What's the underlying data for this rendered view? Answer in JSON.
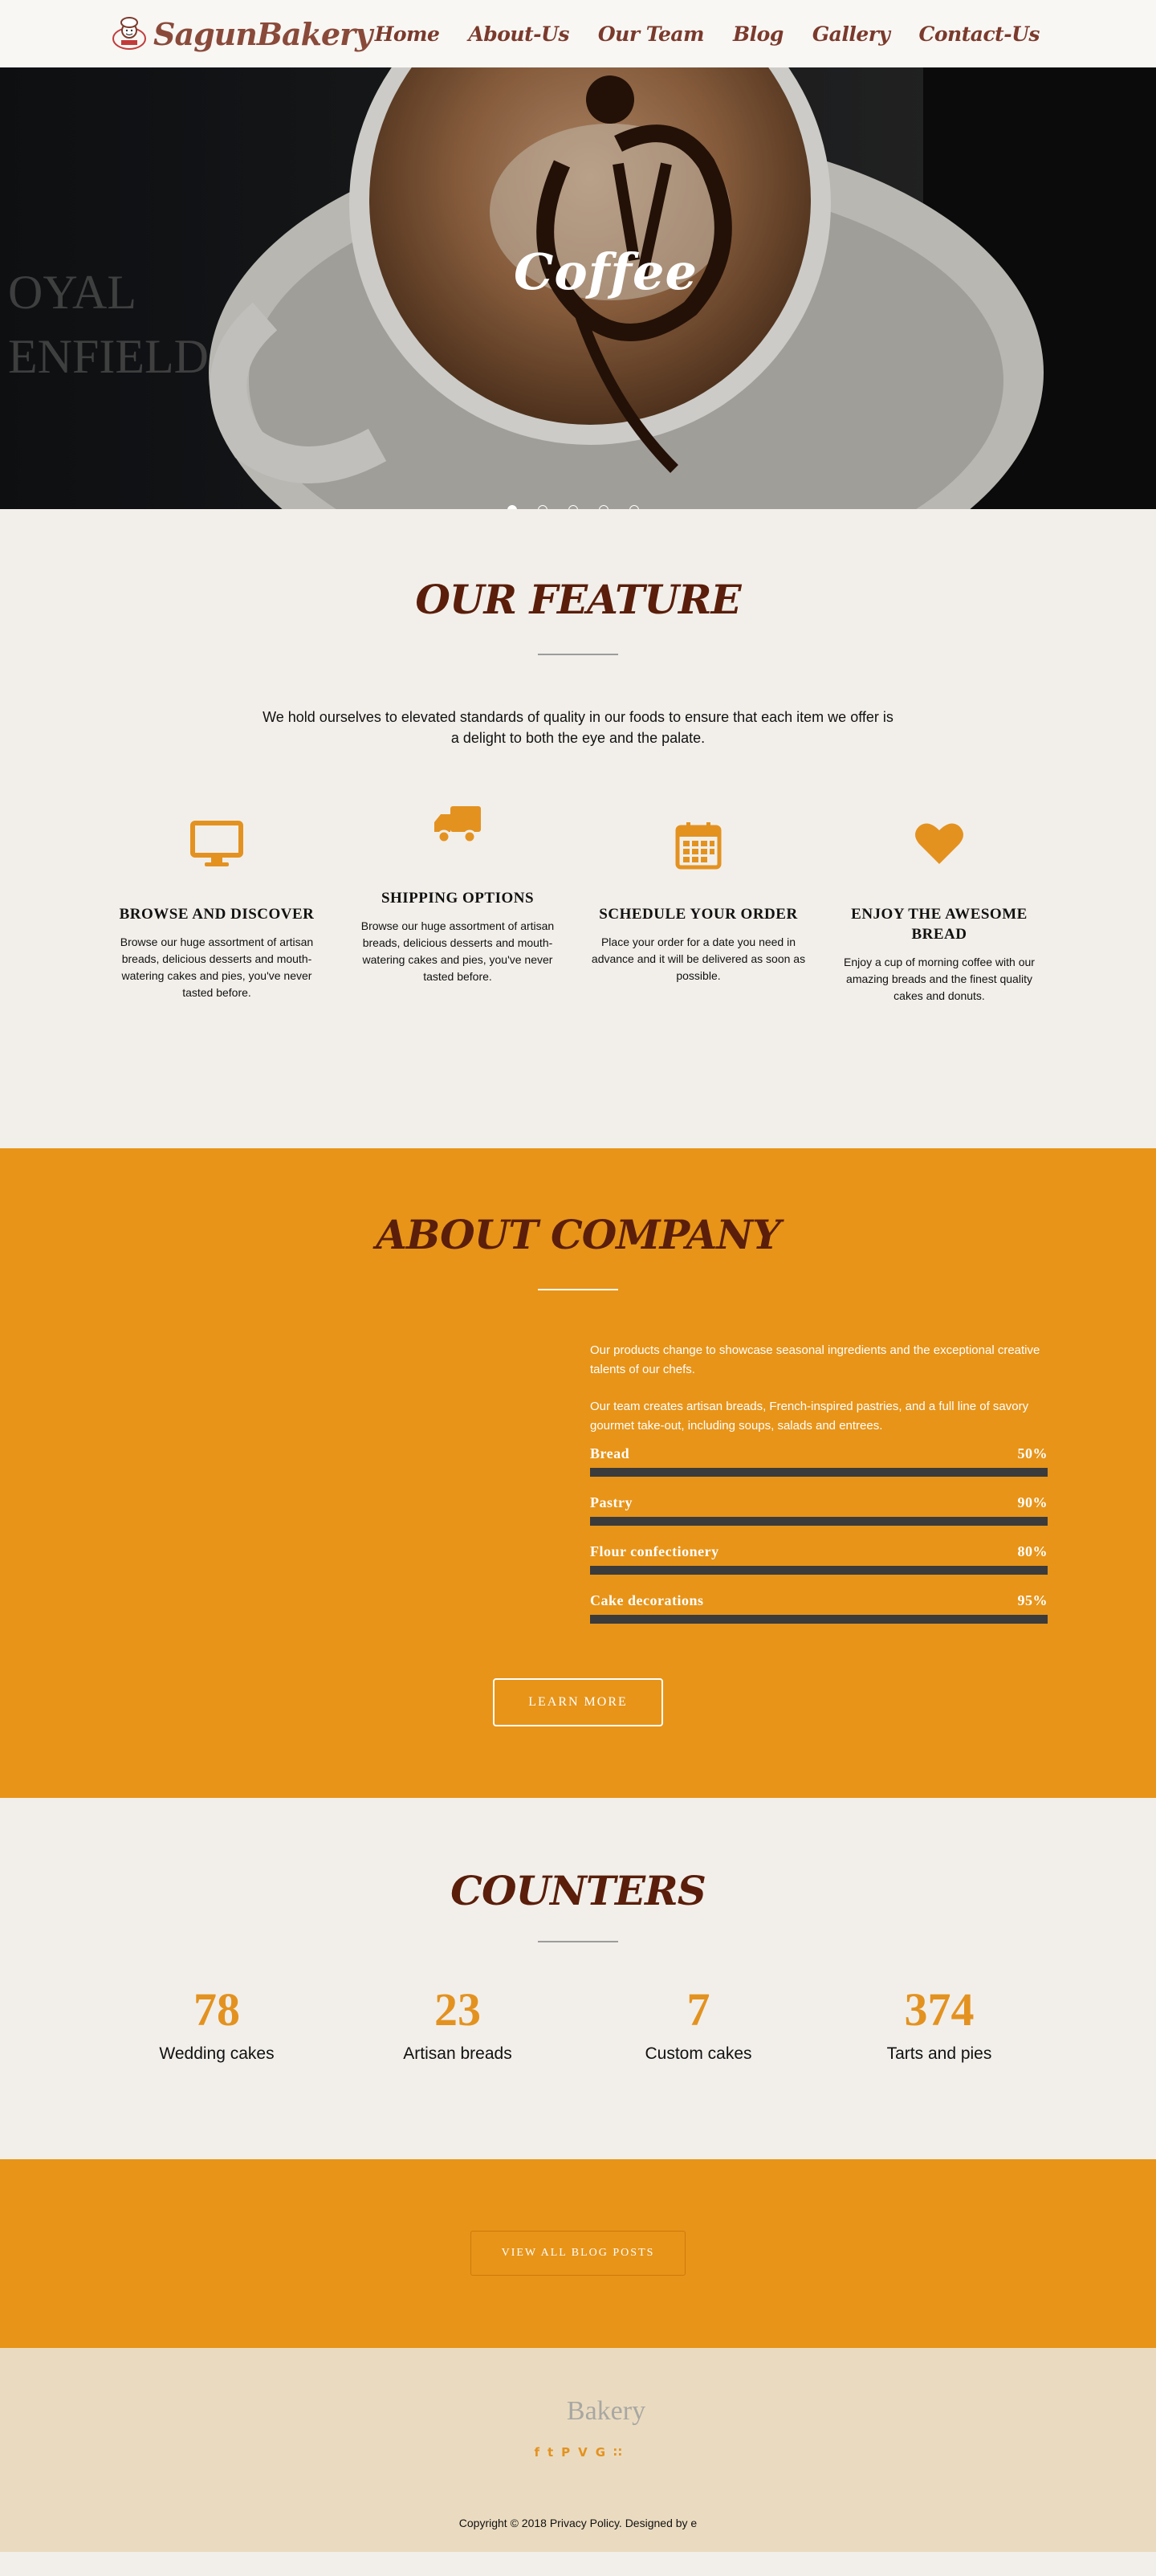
{
  "nav": {
    "brand": "SagunBakery",
    "items": [
      "Home",
      "About-Us",
      "Our Team",
      "Blog",
      "Gallery",
      "Contact-Us"
    ]
  },
  "hero": {
    "title": "Coffee",
    "slide_count": 5,
    "active_slide": 1
  },
  "feature": {
    "title": "OUR FEATURE",
    "description": "We hold ourselves to elevated standards of quality in our foods to ensure that each item we offer is a delight to both the eye and the palate.",
    "items": [
      {
        "icon": "monitor-icon",
        "title": "BROWSE AND DISCOVER",
        "text": "Browse our huge assortment of artisan breads, delicious desserts and mouth-watering cakes and pies, you've never tasted before."
      },
      {
        "icon": "truck-icon",
        "title": "SHIPPING OPTIONS",
        "text": "Browse our huge assortment of artisan breads, delicious desserts and mouth-watering cakes and pies, you've never tasted before."
      },
      {
        "icon": "calendar-icon",
        "title": "SCHEDULE YOUR ORDER",
        "text": "Place your order for a date you need in advance and it will be delivered as soon as possible."
      },
      {
        "icon": "heart-icon",
        "title": "ENJOY THE AWESOME BREAD",
        "text": "Enjoy a cup of morning coffee with our amazing breads and the finest quality cakes and donuts."
      }
    ]
  },
  "about": {
    "title": "ABOUT COMPANY",
    "para1": "Our products change to showcase seasonal ingredients and the exceptional creative talents of our chefs.",
    "para2": "Our team creates artisan breads, French-inspired pastries, and a full line of savory gourmet take-out, including soups, salads and entrees.",
    "skills": [
      {
        "label": "Bread",
        "percent": "50%",
        "value": 50
      },
      {
        "label": "Pastry",
        "percent": "90%",
        "value": 90
      },
      {
        "label": "Flour confectionery",
        "percent": "80%",
        "value": 80
      },
      {
        "label": "Cake decorations",
        "percent": "95%",
        "value": 95
      }
    ],
    "button": "LEARN MORE"
  },
  "counters": {
    "title": "COUNTERS",
    "items": [
      {
        "value": "78",
        "label": "Wedding cakes"
      },
      {
        "value": "23",
        "label": "Artisan breads"
      },
      {
        "value": "7",
        "label": "Custom cakes"
      },
      {
        "value": "374",
        "label": "Tarts and pies"
      }
    ]
  },
  "blog": {
    "button": "VIEW ALL BLOG POSTS"
  },
  "footer": {
    "brand": "Bakery",
    "socials": [
      {
        "icon": "facebook-icon",
        "glyph": "f"
      },
      {
        "icon": "twitter-icon",
        "glyph": "t"
      },
      {
        "icon": "pinterest-icon",
        "glyph": "P"
      },
      {
        "icon": "vimeo-icon",
        "glyph": "V"
      },
      {
        "icon": "google-icon",
        "glyph": "G"
      },
      {
        "icon": "rss-icon",
        "glyph": "∷"
      }
    ],
    "copyright": "Copyright © 2018 Privacy Policy. Designed by e"
  },
  "colors": {
    "accent": "#e79419",
    "title_brown": "#5a1e0a",
    "nav_text": "#7b3a2c",
    "cream": "#f2efea",
    "footer_bg": "#eadbc0"
  }
}
